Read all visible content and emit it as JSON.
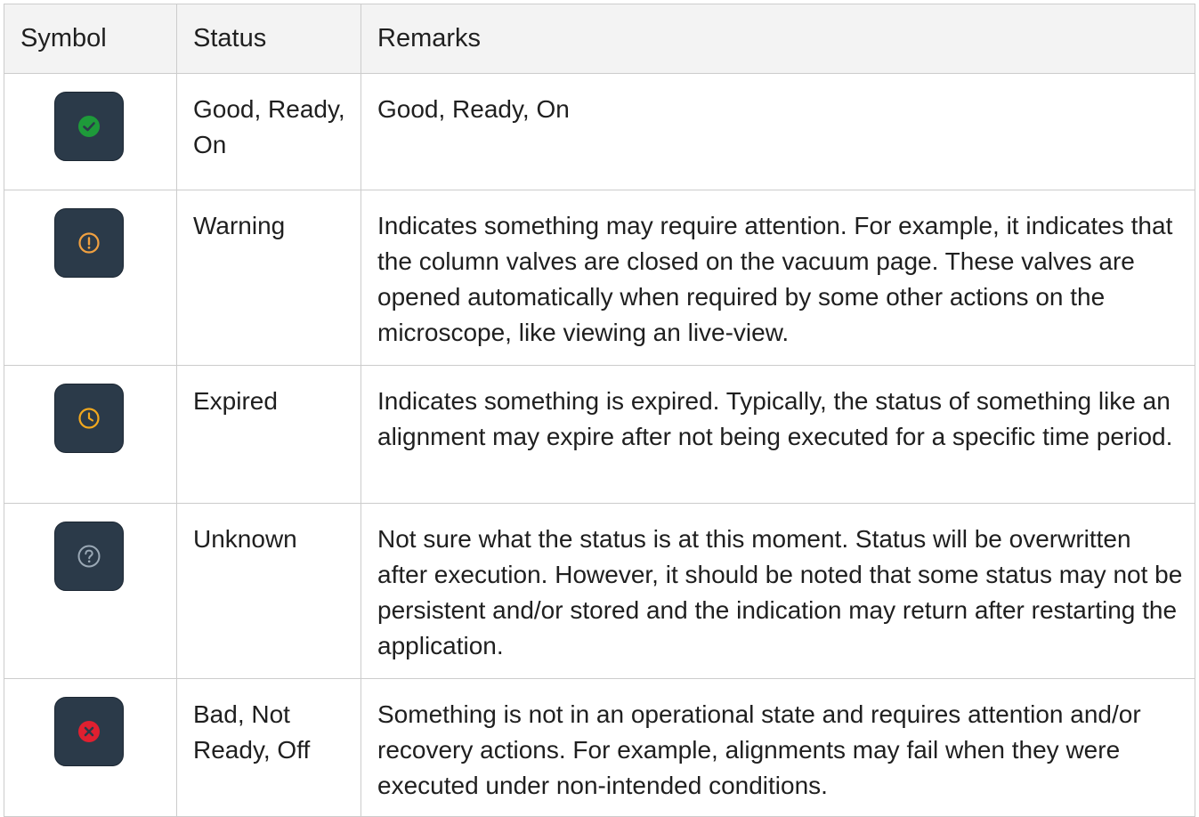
{
  "table": {
    "headers": {
      "symbol": "Symbol",
      "status": "Status",
      "remarks": "Remarks"
    },
    "rows": [
      {
        "icon": "check-circle-icon",
        "icon_color": "#1e9a3a",
        "status": "Good, Ready, On",
        "remarks": "Good, Ready, On"
      },
      {
        "icon": "exclamation-circle-icon",
        "icon_color": "#f0a040",
        "status": "Warning",
        "remarks": "Indicates something may require attention. For example, it indicates that the column valves are closed on the vacuum page. These valves are opened automatically when required by some other actions on the microscope, like viewing an live-view."
      },
      {
        "icon": "clock-icon",
        "icon_color": "#f2a81e",
        "status": "Expired",
        "remarks": "Indicates something is expired. Typically, the status of something like an alignment may expire after not being executed for a specific time period."
      },
      {
        "icon": "question-circle-icon",
        "icon_color": "#9aa8b5",
        "status": "Unknown",
        "remarks": "Not sure what the status is at this moment. Status will be overwritten after execution. However, it should be noted that some status may not be persistent and/or stored and the indication may return after restarting the application."
      },
      {
        "icon": "x-circle-icon",
        "icon_color": "#e02030",
        "status": "Bad, Not Ready, Off",
        "remarks": "Something is not in an operational state and requires attention and/or recovery actions. For example, alignments may fail when they were executed under non-intended conditions."
      }
    ]
  }
}
